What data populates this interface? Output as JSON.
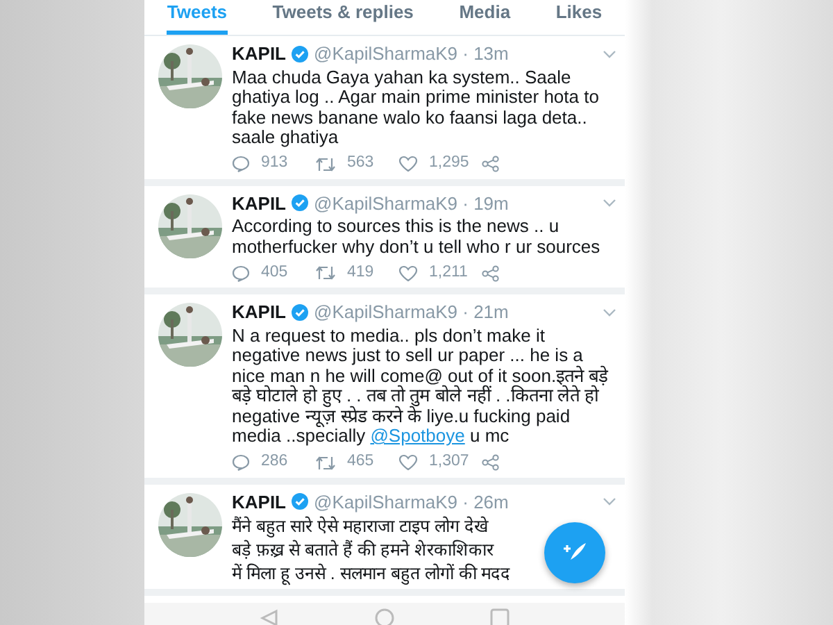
{
  "tabs": [
    {
      "label": "Tweets",
      "selected": true
    },
    {
      "label": "Tweets & replies",
      "selected": false
    },
    {
      "label": "Media",
      "selected": false
    },
    {
      "label": "Likes",
      "selected": false
    }
  ],
  "tweets": [
    {
      "name": "KAPIL",
      "verified": true,
      "meta": "@KapilSharmaK9 · 13m",
      "text": [
        {
          "kind": "plain",
          "text": "Maa chuda Gaya yahan ka system.. Saale ghatiya log .. Agar main prime minister hota to fake news banane walo ko faansi laga deta.. saale ghatiya"
        }
      ],
      "actions": {
        "replies": "913",
        "retweets": "563",
        "likes": "1,295"
      }
    },
    {
      "name": "KAPIL",
      "verified": true,
      "meta": "@KapilSharmaK9 · 19m",
      "text": [
        {
          "kind": "plain",
          "text": "According to sources this is the news .. u motherfucker why don’t u tell who r ur sources"
        }
      ],
      "actions": {
        "replies": "405",
        "retweets": "419",
        "likes": "1,211"
      }
    },
    {
      "name": "KAPIL",
      "verified": true,
      "meta": "@KapilSharmaK9 · 21m",
      "text": [
        {
          "kind": "plain",
          "text": "N a request to media.. pls don’t make it negative news just to sell ur paper ... he is a nice man n he will come@ out of it soon.इतने बड़े बड़े घोटाले हो हुए . . तब तो तुम बोले नहीं . .कितना लेते हो negative न्यूज़ स्प्रेड करने के liye.u fucking paid media ..specially "
        },
        {
          "kind": "mention",
          "text": "@Spotboye"
        },
        {
          "kind": "plain",
          "text": " u mc"
        }
      ],
      "actions": {
        "replies": "286",
        "retweets": "465",
        "likes": "1,307"
      }
    },
    {
      "name": "KAPIL",
      "verified": true,
      "meta": "@KapilSharmaK9 · 26m",
      "lines": [
        "मैंने बहुत सारे ऐसे महाराजा टाइप लोग देखे",
        "बड़े फ़ख़्र से बताते हैं की हमने शेरकाशिकार",
        "में मिला हू  उनसे . सलमान बहुत लोगों की मदद"
      ]
    }
  ]
}
